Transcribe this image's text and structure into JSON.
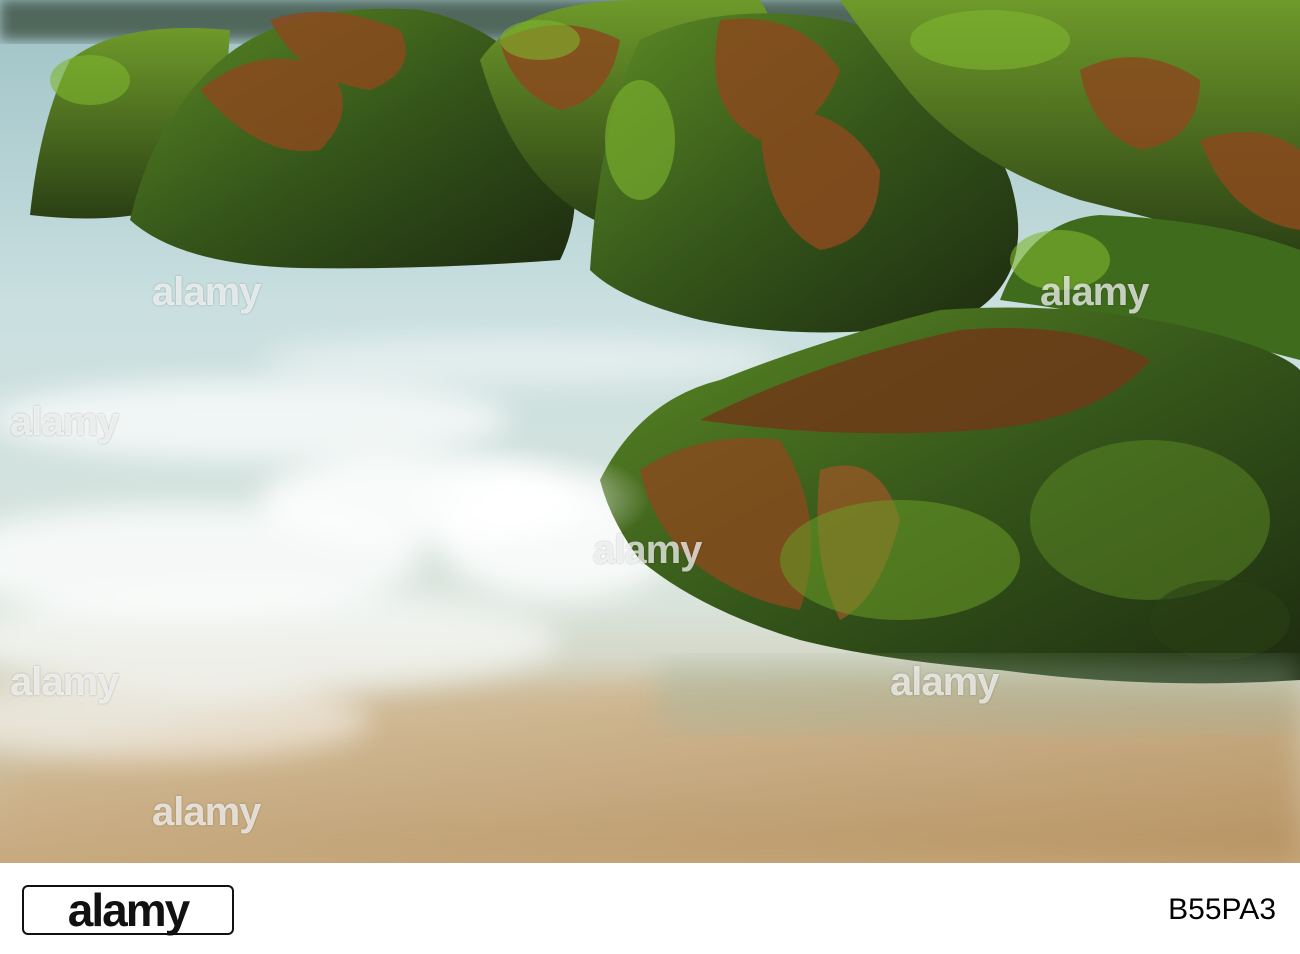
{
  "image": {
    "description_icon": "seaweed-rocks-surf-photo",
    "colors": {
      "water": "#b9d3d6",
      "foam": "#f2f6f4",
      "sand": "#c9a877",
      "rock_green": "#3f6b1c",
      "seaweed": "#8a4a1d",
      "shadow": "#1e2a12"
    }
  },
  "watermarks": [
    {
      "text": "alamy"
    },
    {
      "text": "alamy"
    },
    {
      "text": "alamy"
    },
    {
      "text": "alamy"
    },
    {
      "text": "alamy"
    },
    {
      "text": "alamy"
    },
    {
      "text": "alamy"
    }
  ],
  "footer": {
    "logo_text": "alamy",
    "image_id": "B55PA3"
  }
}
